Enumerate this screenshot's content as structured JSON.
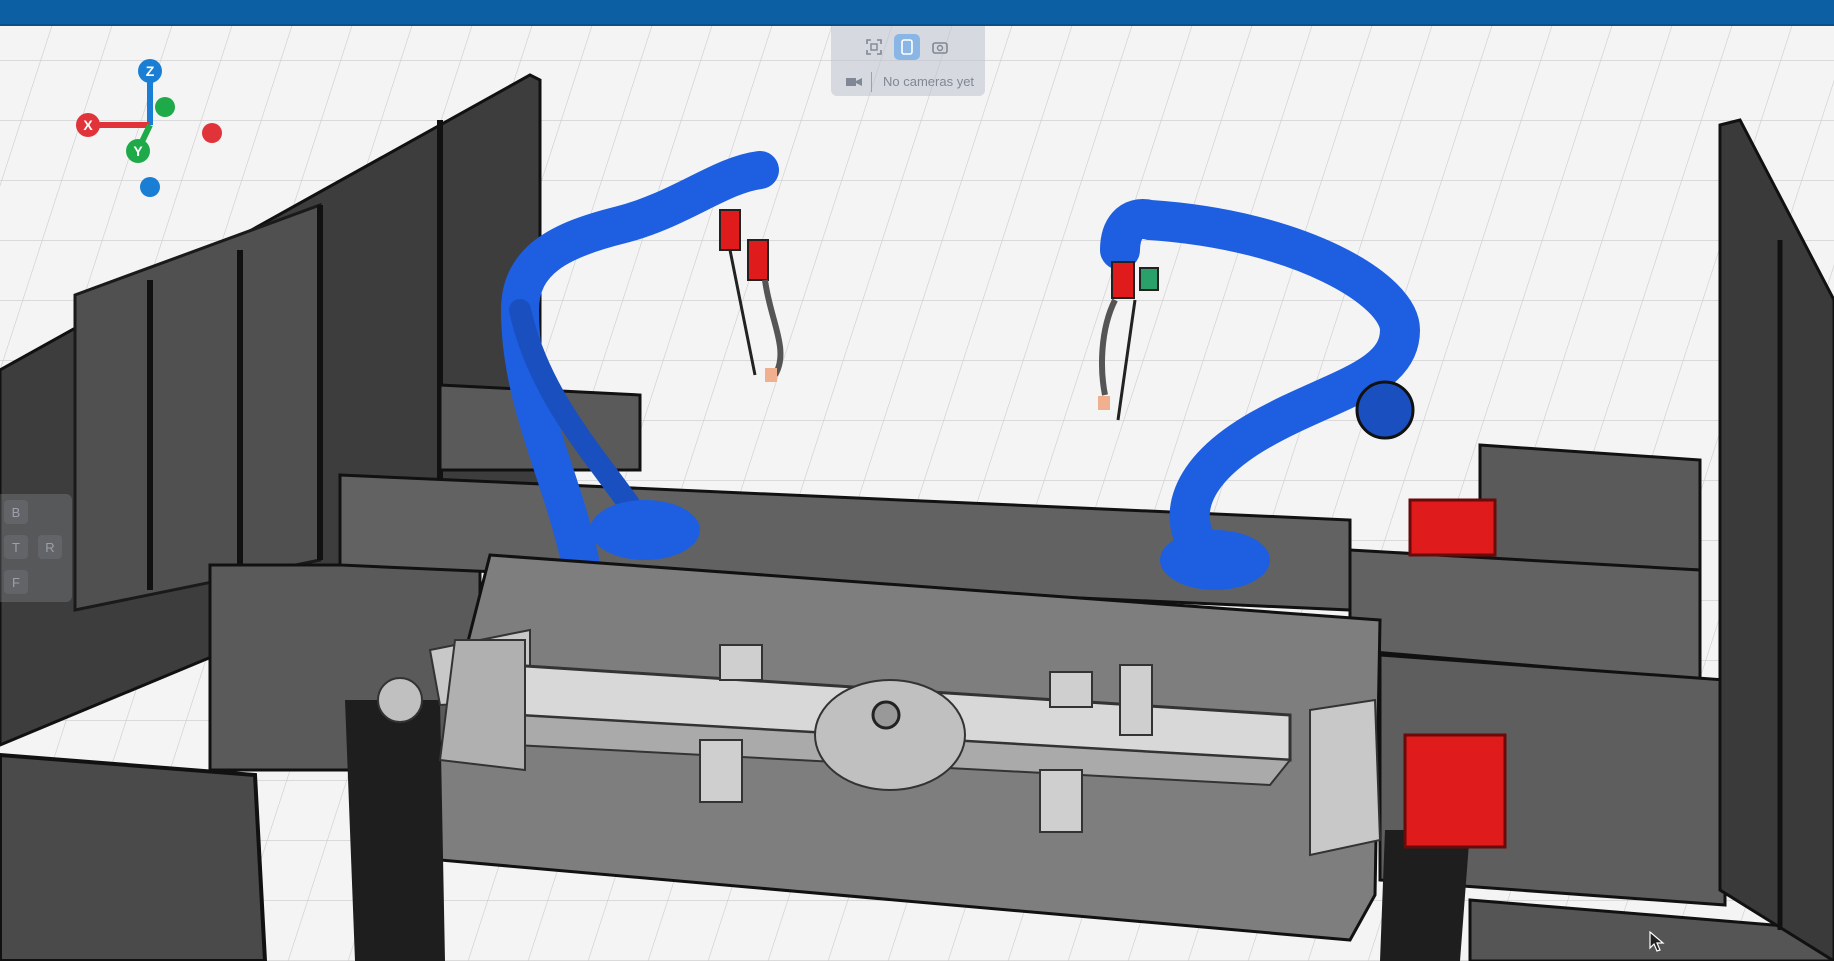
{
  "topbar": {
    "color": "#0d5fa3"
  },
  "axes": {
    "x_label": "X",
    "y_label": "Y",
    "z_label": "Z",
    "x_color": "#e0343a",
    "y_color": "#1faa4a",
    "z_color": "#1a7fd4"
  },
  "camera_panel": {
    "fit_icon": "fit-view-icon",
    "phone_icon": "phone-icon",
    "camera_icon": "camera-icon",
    "empty_text": "No cameras yet"
  },
  "views": {
    "back": "B",
    "top": "T",
    "right": "R",
    "front": "F"
  },
  "scene": {
    "robot_color": "#1d5fe0",
    "motor_color": "#e01b1b",
    "fence_color": "#3a3a3a"
  }
}
